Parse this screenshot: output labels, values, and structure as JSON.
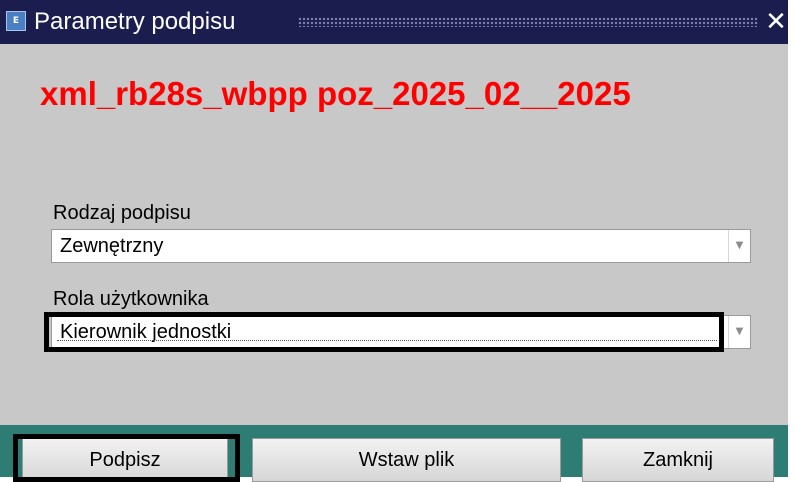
{
  "window": {
    "title": "Parametry podpisu",
    "close_symbol": "✕",
    "icon": "app-icon",
    "icon_glyph": "E"
  },
  "heading": "xml_rb28s_wbpp poz_2025_02__2025",
  "form": {
    "signature_type": {
      "label": "Rodzaj podpisu",
      "value": "Zewnętrzny"
    },
    "user_role": {
      "label": "Rola użytkownika",
      "value": "Kierownik jednostki"
    },
    "dropdown_symbol": "▼"
  },
  "buttons": {
    "sign": "Podpisz",
    "insert_file": "Wstaw plik",
    "close": "Zamknij"
  },
  "colors": {
    "title_bar": "#1b1d4e",
    "heading": "#ff0000",
    "dialog_bg": "#c8c8c8",
    "button_bar": "#2e7d74"
  }
}
